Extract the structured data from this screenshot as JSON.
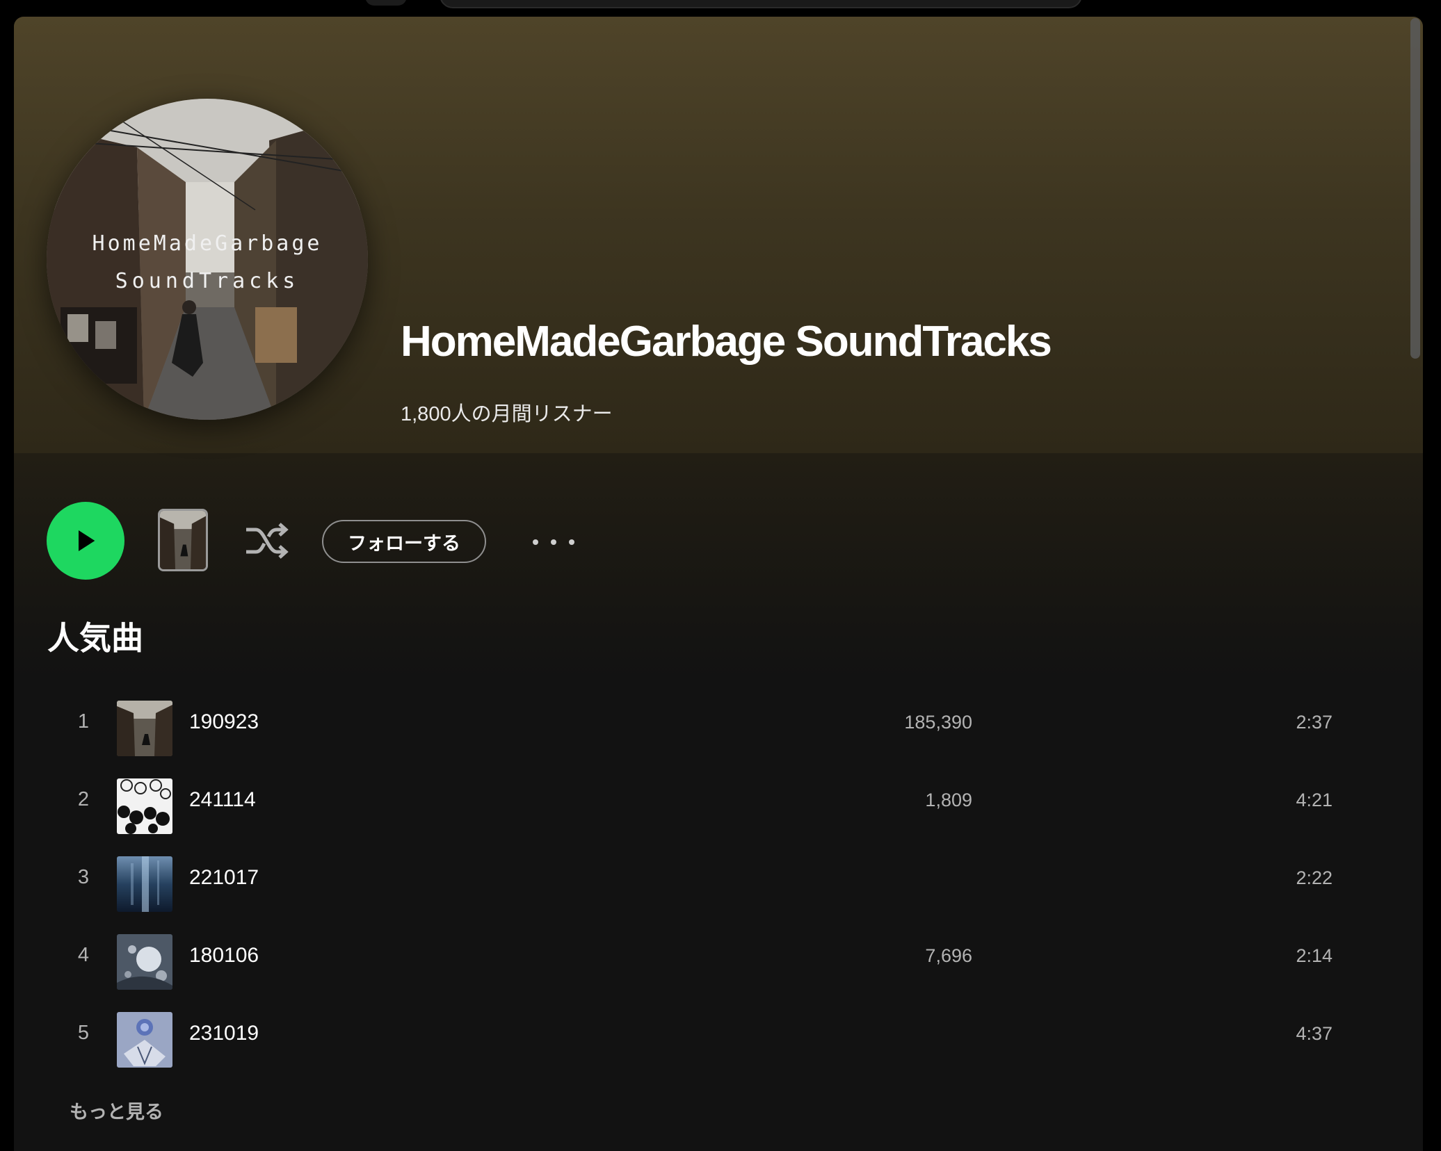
{
  "artist": {
    "name": "HomeMadeGarbage SoundTracks",
    "monthly_listeners": "1,800人の月間リスナー",
    "avatar_text_line1": "HomeMadeGarbage",
    "avatar_text_line2": "SoundTracks"
  },
  "controls": {
    "play_icon": "play-icon",
    "shuffle_icon": "shuffle-icon",
    "follow_label": "フォローする",
    "more_icon": "more-icon"
  },
  "popular": {
    "title": "人気曲",
    "tracks": [
      {
        "rank": "1",
        "title": "190923",
        "plays": "185,390",
        "duration": "2:37"
      },
      {
        "rank": "2",
        "title": "241114",
        "plays": "1,809",
        "duration": "4:21"
      },
      {
        "rank": "3",
        "title": "221017",
        "plays": "",
        "duration": "2:22"
      },
      {
        "rank": "4",
        "title": "180106",
        "plays": "7,696",
        "duration": "2:14"
      },
      {
        "rank": "5",
        "title": "231019",
        "plays": "",
        "duration": "4:37"
      }
    ],
    "show_more": "もっと見る"
  },
  "colors": {
    "accent": "#1ed760",
    "hero": "#4f4429",
    "background": "#121212"
  }
}
